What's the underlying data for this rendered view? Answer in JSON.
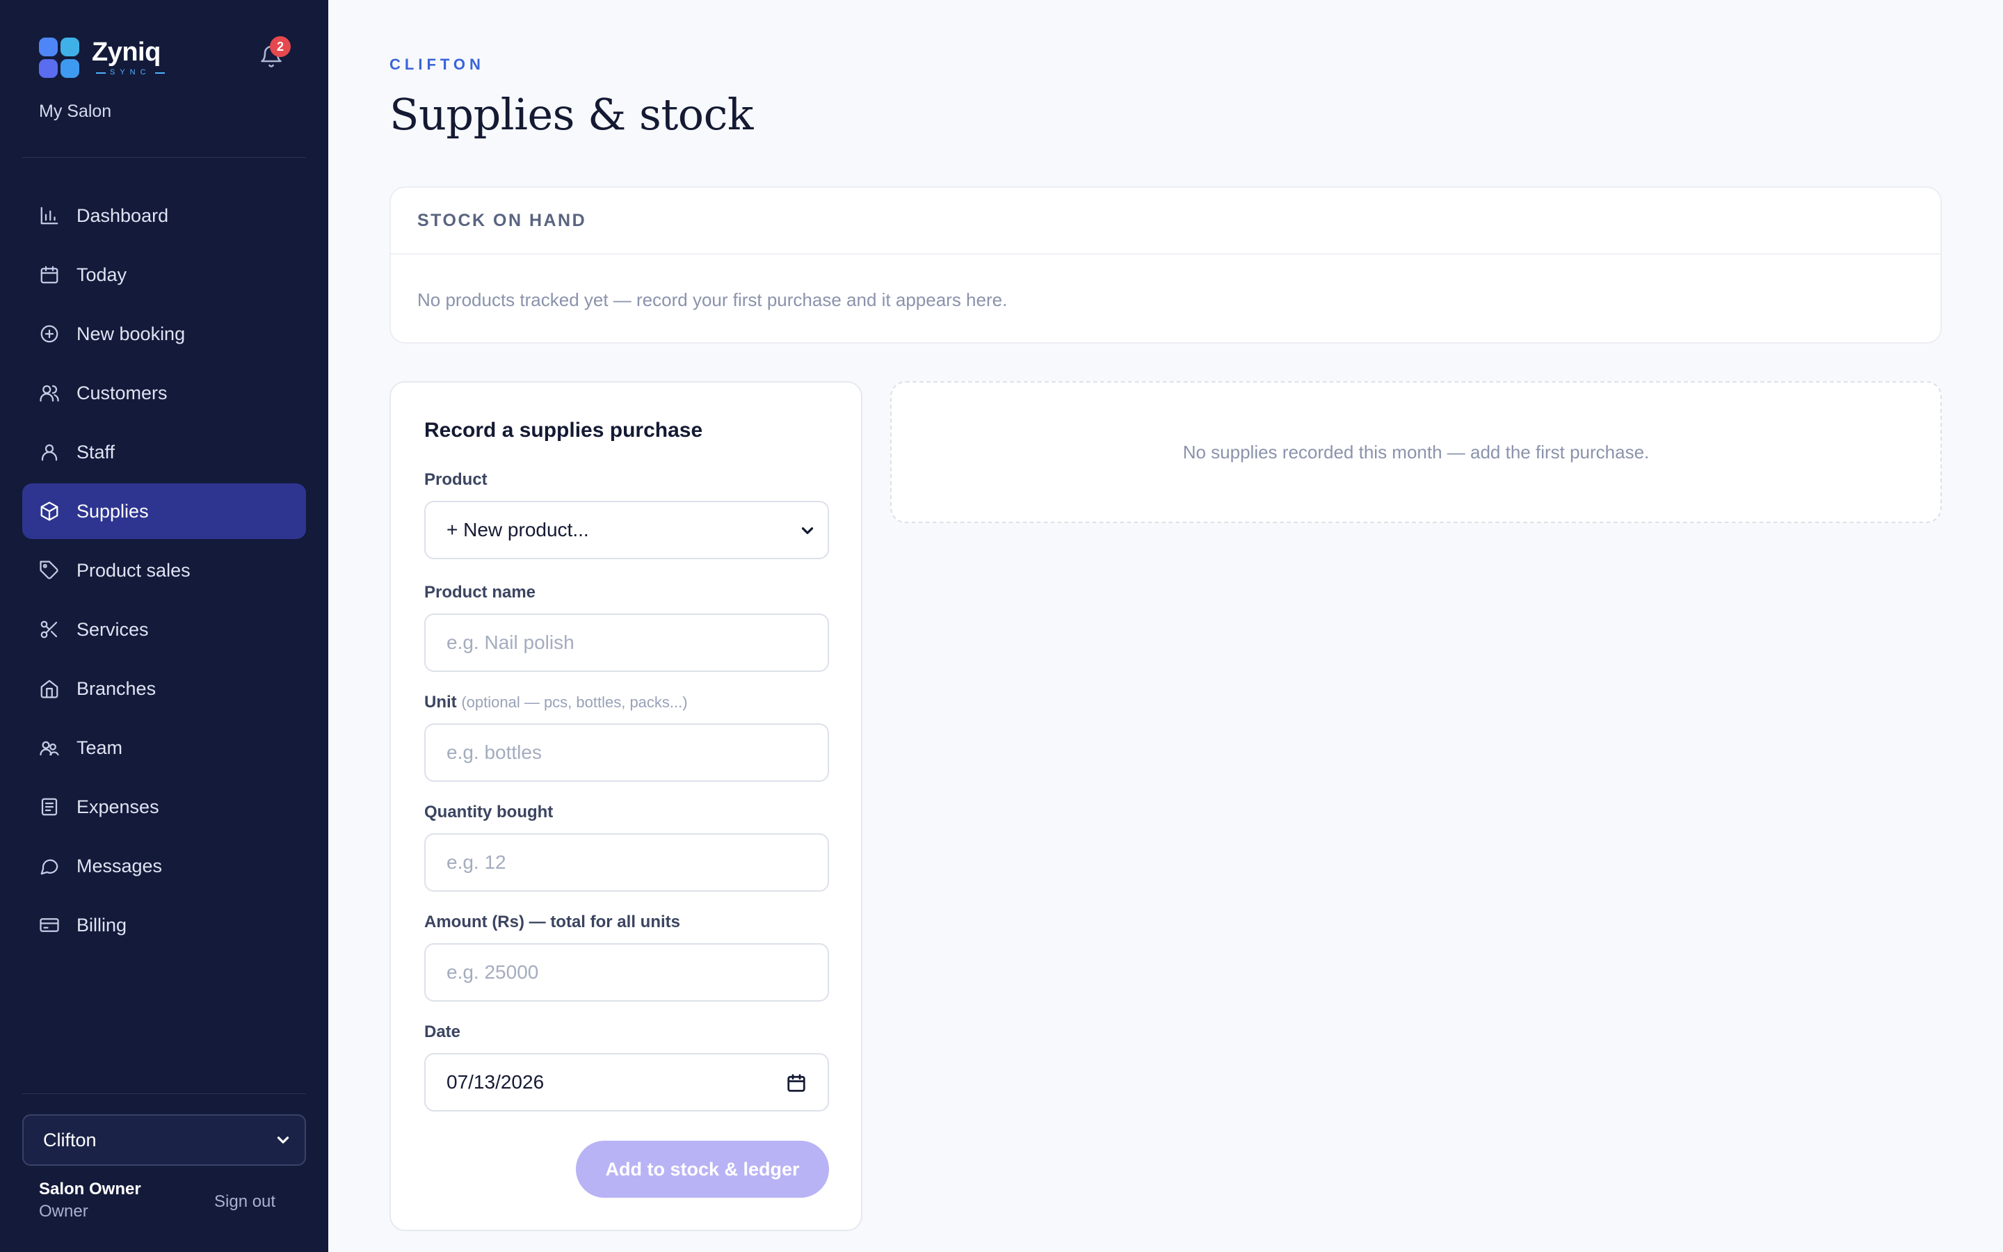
{
  "app": {
    "brand_name": "Zyniq",
    "brand_sub": "SYNC",
    "salon_name": "My Salon",
    "notification_count": "2"
  },
  "sidebar": {
    "items": [
      {
        "label": "Dashboard",
        "icon": "bar-chart-icon"
      },
      {
        "label": "Today",
        "icon": "calendar-icon"
      },
      {
        "label": "New booking",
        "icon": "plus-circle-icon"
      },
      {
        "label": "Customers",
        "icon": "users-icon"
      },
      {
        "label": "Staff",
        "icon": "user-icon"
      },
      {
        "label": "Supplies",
        "icon": "box-icon",
        "active": true
      },
      {
        "label": "Product sales",
        "icon": "tag-icon"
      },
      {
        "label": "Services",
        "icon": "scissors-icon"
      },
      {
        "label": "Branches",
        "icon": "home-icon"
      },
      {
        "label": "Team",
        "icon": "team-icon"
      },
      {
        "label": "Expenses",
        "icon": "receipt-icon"
      },
      {
        "label": "Messages",
        "icon": "chat-icon"
      },
      {
        "label": "Billing",
        "icon": "credit-card-icon"
      }
    ],
    "branch_selected": "Clifton",
    "user_name": "Salon Owner",
    "user_role": "Owner",
    "signout_label": "Sign out"
  },
  "page": {
    "eyebrow": "CLIFTON",
    "title": "Supplies & stock"
  },
  "stock": {
    "heading": "STOCK ON HAND",
    "empty_text": "No products tracked yet — record your first purchase and it appears here."
  },
  "form": {
    "title": "Record a supplies purchase",
    "product_label": "Product",
    "product_value": "+ New product...",
    "name_label": "Product name",
    "name_placeholder": "e.g. Nail polish",
    "unit_label": "Unit",
    "unit_hint": "(optional — pcs, bottles, packs...)",
    "unit_placeholder": "e.g. bottles",
    "qty_label": "Quantity bought",
    "qty_placeholder": "e.g. 12",
    "amount_label": "Amount (Rs) — total for all units",
    "amount_placeholder": "e.g. 25000",
    "date_label": "Date",
    "date_value": "07/13/2026",
    "submit_label": "Add to stock & ledger"
  },
  "supplies": {
    "empty_text": "No supplies recorded this month — add the first purchase."
  },
  "colors": {
    "sidebar_bg": "#131a3a",
    "active_bg": "#2e3590",
    "accent": "#3a63d8",
    "button_disabled": "#b8b3f5",
    "badge": "#e5484d"
  }
}
